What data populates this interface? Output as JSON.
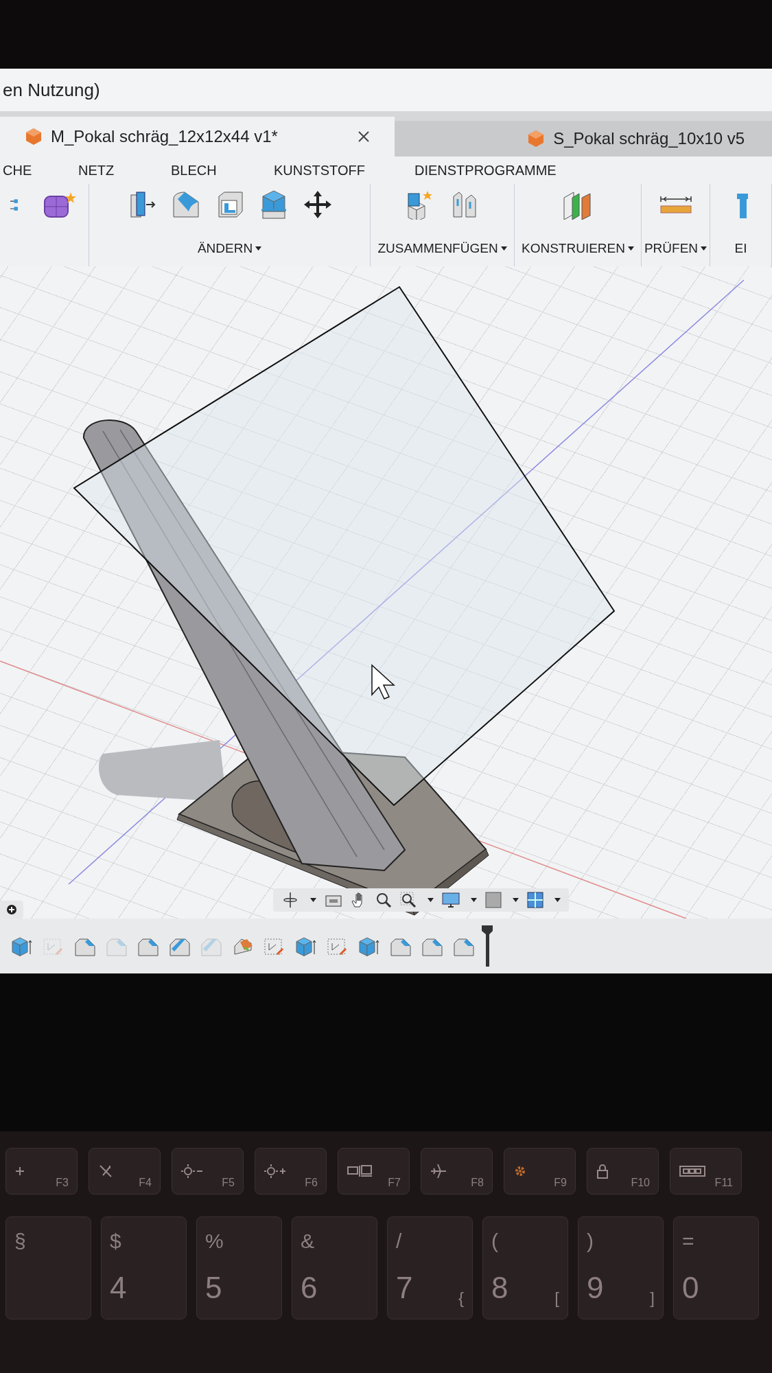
{
  "window": {
    "title": "en Nutzung)"
  },
  "tabs": [
    {
      "label": "M_Pokal schräg_12x12x44 v1*",
      "selected": true,
      "closable": true
    },
    {
      "label": "S_Pokal schräg_10x10 v5",
      "selected": false,
      "closable": false
    }
  ],
  "toolbar": {
    "categories": [
      "CHE",
      "NETZ",
      "BLECH",
      "KUNSTSTOFF",
      "DIENSTPROGRAMME"
    ],
    "groups": [
      {
        "kind": "create"
      },
      {
        "kind": "modify",
        "label": "ÄNDERN"
      },
      {
        "kind": "assemble",
        "label": "ZUSAMMENFÜGEN"
      },
      {
        "kind": "construct",
        "label": "KONSTRUIEREN"
      },
      {
        "kind": "inspect",
        "label": "PRÜFEN"
      },
      {
        "kind": "insert",
        "label": "EI"
      }
    ]
  },
  "timeline": [
    {
      "kind": "extrude",
      "disabled": false
    },
    {
      "kind": "sketch",
      "disabled": true
    },
    {
      "kind": "fillet",
      "disabled": false
    },
    {
      "kind": "fillet",
      "disabled": true
    },
    {
      "kind": "fillet",
      "disabled": false
    },
    {
      "kind": "chamfer",
      "disabled": false
    },
    {
      "kind": "chamfer",
      "disabled": true
    },
    {
      "kind": "appearance",
      "disabled": false
    },
    {
      "kind": "sketch",
      "disabled": false
    },
    {
      "kind": "extrude",
      "disabled": false
    },
    {
      "kind": "sketch",
      "disabled": false
    },
    {
      "kind": "extrude",
      "disabled": false
    },
    {
      "kind": "fillet",
      "disabled": false
    },
    {
      "kind": "fillet",
      "disabled": false
    },
    {
      "kind": "fillet",
      "disabled": false
    }
  ],
  "keyboard": {
    "function_row": [
      {
        "kind": "plus",
        "fn": "F3"
      },
      {
        "kind": "mute",
        "fn": "F4"
      },
      {
        "kind": "brightness-down",
        "fn": "F5"
      },
      {
        "kind": "brightness-up",
        "fn": "F6"
      },
      {
        "kind": "display",
        "fn": "F7"
      },
      {
        "kind": "airplane",
        "fn": "F8"
      },
      {
        "kind": "gear",
        "fn": "F9"
      },
      {
        "kind": "lock",
        "fn": "F10"
      },
      {
        "kind": "keyboard",
        "fn": "F11"
      }
    ],
    "number_row": [
      {
        "top": "§"
      },
      {
        "top": "$",
        "main": "4"
      },
      {
        "top": "%",
        "main": "5"
      },
      {
        "top": "&",
        "main": "6"
      },
      {
        "top": "/",
        "main": "7",
        "alt": "{"
      },
      {
        "top": "(",
        "main": "8",
        "alt": "["
      },
      {
        "top": ")",
        "main": "9",
        "alt": "]"
      },
      {
        "top": "=",
        "main": "0"
      }
    ]
  }
}
